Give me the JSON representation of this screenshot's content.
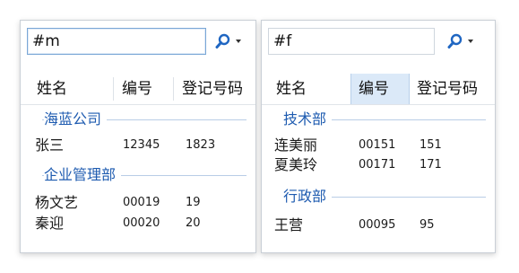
{
  "panels": [
    {
      "search_value": "#m",
      "columns": [
        "姓名",
        "编号",
        "登记号码"
      ],
      "groups": [
        {
          "label": "海蓝公司",
          "rows": [
            {
              "name": "张三",
              "code": "12345",
              "reg": "1823"
            }
          ]
        },
        {
          "label": "企业管理部",
          "rows": [
            {
              "name": "杨文艺",
              "code": "00019",
              "reg": "19"
            },
            {
              "name": "秦迎",
              "code": "00020",
              "reg": "20"
            }
          ]
        }
      ]
    },
    {
      "search_value": "#f",
      "columns": [
        "姓名",
        "编号",
        "登记号码"
      ],
      "groups": [
        {
          "label": "技术部",
          "rows": [
            {
              "name": "连美丽",
              "code": "00151",
              "reg": "151"
            },
            {
              "name": "夏美玲",
              "code": "00171",
              "reg": "171"
            }
          ]
        },
        {
          "label": "行政部",
          "rows": [
            {
              "name": "王营",
              "code": "00095",
              "reg": "95"
            }
          ]
        }
      ]
    }
  ],
  "icons": {
    "search": "search-icon",
    "dropdown": "chevron-down-icon"
  },
  "colors": {
    "group_label": "#1e5bb0",
    "search_border": "#7aa7d6",
    "selected_header": "#dbe9f8"
  }
}
